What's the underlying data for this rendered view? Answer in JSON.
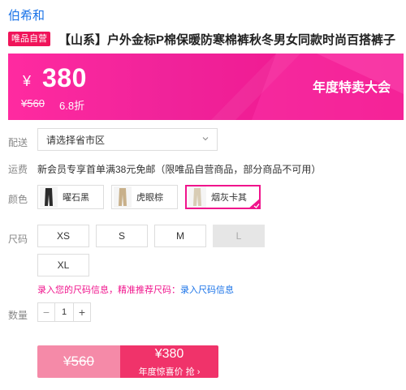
{
  "brand": "伯希和",
  "product": {
    "tag": "唯品自营",
    "title": "【山系】户外金标P棉保暖防寒棉裤秋冬男女同款时尚百搭裤子"
  },
  "price_banner": {
    "currency": "¥",
    "price": "380",
    "original_price": "¥560",
    "discount": "6.8折",
    "event": "年度特卖大会"
  },
  "labels": {
    "delivery": "配送",
    "shipping": "运费",
    "color": "颜色",
    "size": "尺码",
    "quantity": "数量"
  },
  "delivery": {
    "select_text": "请选择省市区",
    "icon": "chevron-down-icon"
  },
  "shipping_text": "新会员专享首单满38元免邮（限唯品自营商品，部分商品不可用）",
  "colors": [
    {
      "name": "曜石黑",
      "selected": false,
      "swatch": "#2a2a2a"
    },
    {
      "name": "虎眼棕",
      "selected": false,
      "swatch": "#c8b08a"
    },
    {
      "name": "烟灰卡其",
      "selected": true,
      "swatch": "#d8ccb4"
    }
  ],
  "sizes": [
    {
      "label": "XS",
      "available": true
    },
    {
      "label": "S",
      "available": true
    },
    {
      "label": "M",
      "available": true
    },
    {
      "label": "L",
      "available": false
    },
    {
      "label": "XL",
      "available": true
    }
  ],
  "size_info": {
    "prompt": "录入您的尺码信息，精准推荐尺码：",
    "link": "录入尺码信息"
  },
  "quantity": {
    "minus": "−",
    "value": "1",
    "plus": "+"
  },
  "buy": {
    "original": "¥560",
    "price": "¥380",
    "sub": "年度惊喜价 抢 ›"
  },
  "colors_theme": {
    "accent": "#f0148c",
    "link": "#1a73e8",
    "buy_left": "#f58aa8",
    "buy_right": "#f0336a"
  }
}
